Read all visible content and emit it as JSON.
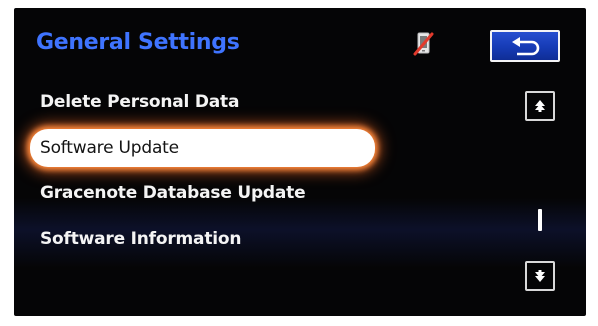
{
  "header": {
    "title": "General Settings"
  },
  "icons": {
    "phone_status": "phone-disconnected-icon",
    "back": "back-arrow-icon",
    "scroll_up": "page-up-icon",
    "scroll_down": "page-down-icon"
  },
  "menu": {
    "items": [
      {
        "label": "Delete Personal Data",
        "selected": false
      },
      {
        "label": "Software Update",
        "selected": true
      },
      {
        "label": "Gracenote Database Update",
        "selected": false
      },
      {
        "label": "Software Information",
        "selected": false
      }
    ]
  },
  "colors": {
    "title": "#3f74ff",
    "highlight_glow": "#ff8a3c",
    "back_button": "#163bb5",
    "background": "#050506"
  }
}
